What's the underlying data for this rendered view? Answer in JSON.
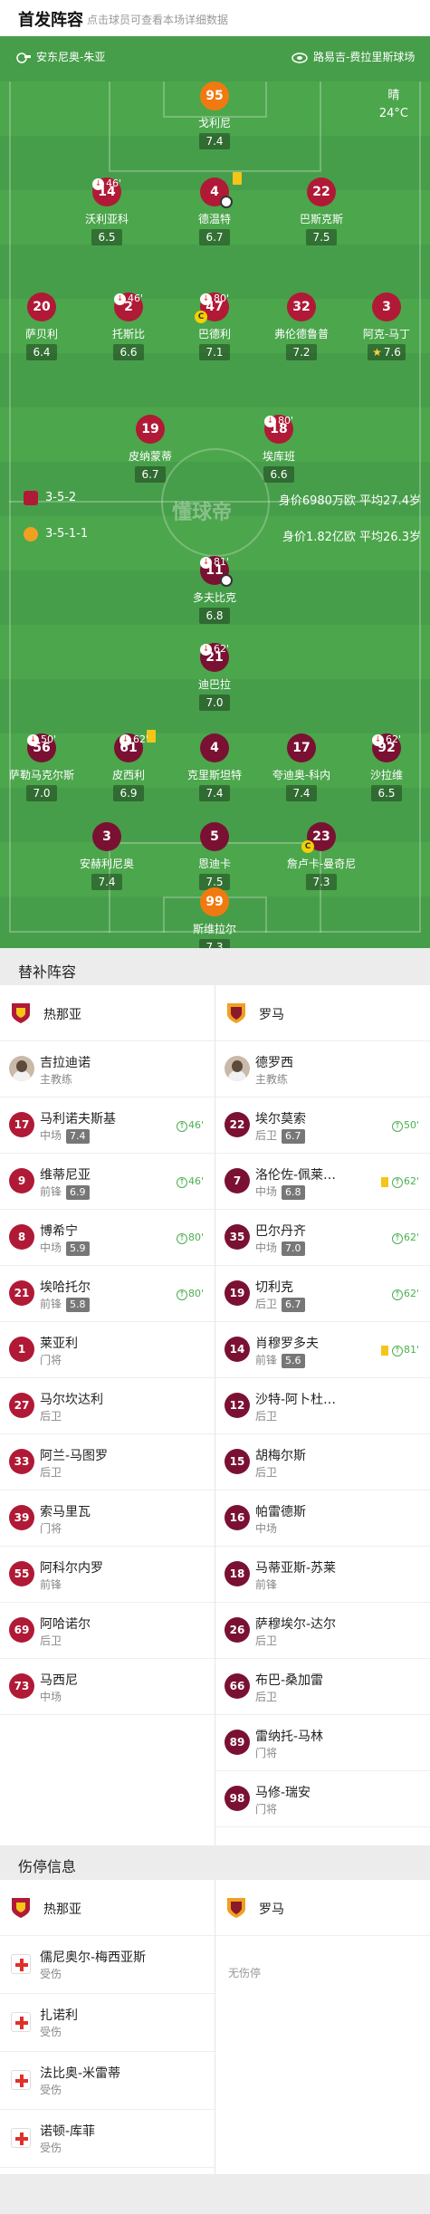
{
  "header": {
    "title": "首发阵容",
    "hint": "点击球员可查看本场详细数据"
  },
  "pitch": {
    "home_manager": "安东尼奥-朱亚",
    "away_manager": "路易吉-费拉里斯球场",
    "weather": "晴",
    "temperature": "24°C",
    "watermark": "懂球帝",
    "home_formation": "3-5-2",
    "home_value": "身价6980万欧 平均27.4岁",
    "away_formation": "3-5-1-1",
    "away_value": "身价1.82亿欧 平均26.3岁"
  },
  "home_lineup": [
    {
      "num": "95",
      "name": "戈利尼",
      "rating": "7.4"
    },
    {
      "num": "14",
      "name": "沃利亚科",
      "rating": "6.5",
      "sub": "46'"
    },
    {
      "num": "4",
      "name": "德温特",
      "rating": "6.7"
    },
    {
      "num": "22",
      "name": "巴斯克斯",
      "rating": "7.5"
    },
    {
      "num": "20",
      "name": "萨贝利",
      "rating": "6.4"
    },
    {
      "num": "2",
      "name": "托斯比",
      "rating": "6.6",
      "sub": "46'"
    },
    {
      "num": "47",
      "name": "巴德利",
      "rating": "7.1",
      "sub": "80'"
    },
    {
      "num": "32",
      "name": "弗伦德鲁普",
      "rating": "7.2"
    },
    {
      "num": "3",
      "name": "阿克-马丁",
      "rating": "7.6"
    },
    {
      "num": "19",
      "name": "皮纳蒙蒂",
      "rating": "6.7"
    },
    {
      "num": "18",
      "name": "埃库班",
      "rating": "6.6",
      "sub": "80'"
    }
  ],
  "away_lineup": [
    {
      "num": "11",
      "name": "多夫比克",
      "rating": "6.8",
      "sub": "81'"
    },
    {
      "num": "21",
      "name": "迪巴拉",
      "rating": "7.0",
      "sub": "62'"
    },
    {
      "num": "56",
      "name": "萨勒马克尔斯",
      "rating": "7.0",
      "sub": "50'"
    },
    {
      "num": "61",
      "name": "皮西利",
      "rating": "6.9",
      "sub": "62'"
    },
    {
      "num": "4",
      "name": "克里斯坦特",
      "rating": "7.4"
    },
    {
      "num": "17",
      "name": "夸迪奥-科内",
      "rating": "7.4"
    },
    {
      "num": "92",
      "name": "沙拉维",
      "rating": "6.5",
      "sub": "62'"
    },
    {
      "num": "3",
      "name": "安赫利尼奥",
      "rating": "7.4"
    },
    {
      "num": "5",
      "name": "恩迪卡",
      "rating": "7.5"
    },
    {
      "num": "23",
      "name": "詹卢卡-曼奇尼",
      "rating": "7.3"
    },
    {
      "num": "99",
      "name": "斯维拉尔",
      "rating": "7.3"
    }
  ],
  "subs": {
    "title": "替补阵容",
    "home_team": "热那亚",
    "away_team": "罗马",
    "home_coach": {
      "name": "吉拉迪诺",
      "role": "主教练"
    },
    "away_coach": {
      "name": "德罗西",
      "role": "主教练"
    },
    "home": [
      {
        "num": "17",
        "name": "马利诺夫斯基",
        "pos": "中场",
        "rating": "7.4",
        "ev": "46'"
      },
      {
        "num": "9",
        "name": "维蒂尼亚",
        "pos": "前锋",
        "rating": "6.9",
        "ev": "46'"
      },
      {
        "num": "8",
        "name": "博希宁",
        "pos": "中场",
        "rating": "5.9",
        "ev": "80'"
      },
      {
        "num": "21",
        "name": "埃哈托尔",
        "pos": "前锋",
        "rating": "5.8",
        "ev": "80'"
      },
      {
        "num": "1",
        "name": "莱亚利",
        "pos": "门将"
      },
      {
        "num": "27",
        "name": "马尔坎达利",
        "pos": "后卫"
      },
      {
        "num": "33",
        "name": "阿兰-马图罗",
        "pos": "后卫"
      },
      {
        "num": "39",
        "name": "索马里瓦",
        "pos": "门将"
      },
      {
        "num": "55",
        "name": "阿科尔内罗",
        "pos": "前锋"
      },
      {
        "num": "69",
        "name": "阿哈诺尔",
        "pos": "后卫"
      },
      {
        "num": "73",
        "name": "马西尼",
        "pos": "中场"
      }
    ],
    "away": [
      {
        "num": "22",
        "name": "埃尔莫索",
        "pos": "后卫",
        "rating": "6.7",
        "ev": "50'"
      },
      {
        "num": "7",
        "name": "洛伦佐-佩莱…",
        "pos": "中场",
        "rating": "6.8",
        "ev": "62'",
        "yellow": true
      },
      {
        "num": "35",
        "name": "巴尔丹齐",
        "pos": "中场",
        "rating": "7.0",
        "ev": "62'"
      },
      {
        "num": "19",
        "name": "切利克",
        "pos": "后卫",
        "rating": "6.7",
        "ev": "62'"
      },
      {
        "num": "14",
        "name": "肖穆罗多夫",
        "pos": "前锋",
        "rating": "5.6",
        "ev": "81'",
        "yellow": true
      },
      {
        "num": "12",
        "name": "沙特-阿卜杜…",
        "pos": "后卫"
      },
      {
        "num": "15",
        "name": "胡梅尔斯",
        "pos": "后卫"
      },
      {
        "num": "16",
        "name": "帕雷德斯",
        "pos": "中场"
      },
      {
        "num": "18",
        "name": "马蒂亚斯-苏莱",
        "pos": "前锋"
      },
      {
        "num": "26",
        "name": "萨穆埃尔-达尔",
        "pos": "后卫"
      },
      {
        "num": "66",
        "name": "布巴-桑加雷",
        "pos": "后卫"
      },
      {
        "num": "89",
        "name": "雷纳托-马林",
        "pos": "门将"
      },
      {
        "num": "98",
        "name": "马修-瑞安",
        "pos": "门将"
      }
    ]
  },
  "injuries": {
    "title": "伤停信息",
    "home_team": "热那亚",
    "away_team": "罗马",
    "away_none": "无伤停",
    "home": [
      {
        "name": "儒尼奥尔-梅西亚斯",
        "status": "受伤"
      },
      {
        "name": "扎诺利",
        "status": "受伤"
      },
      {
        "name": "法比奥-米雷蒂",
        "status": "受伤"
      },
      {
        "name": "诺顿-库菲",
        "status": "受伤"
      }
    ]
  },
  "colors": {
    "pitch": "#4ca64c",
    "home": "#b01a36",
    "away": "#7a1133",
    "keeper": "#f07a10",
    "rating_star": "#ffd23f"
  }
}
